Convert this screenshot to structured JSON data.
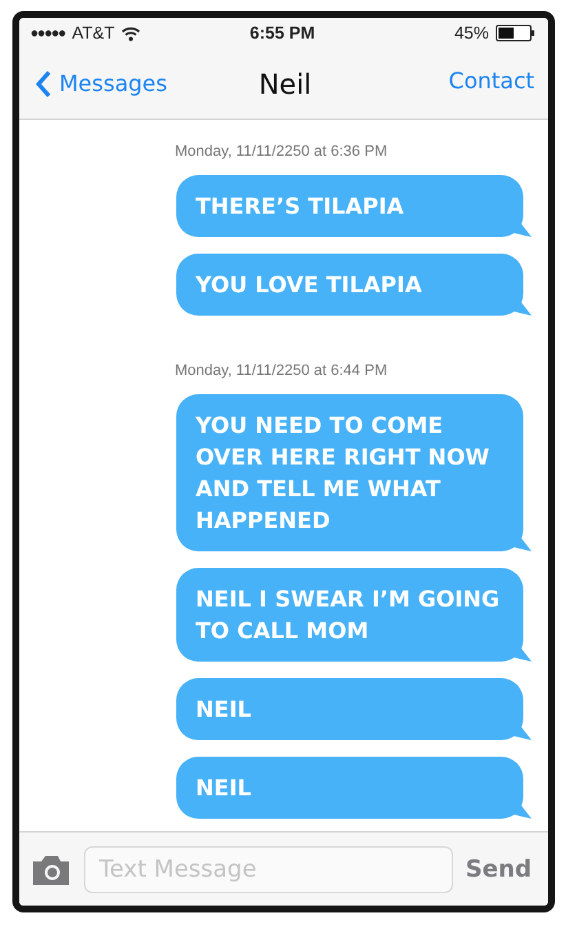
{
  "status_bar": {
    "signal_dots": "●●●●●",
    "carrier": "AT&T",
    "time": "6:55 PM",
    "battery": "45%"
  },
  "nav": {
    "back": "Messages",
    "title": "Neil",
    "action": "Contact"
  },
  "groups": [
    {
      "timestamp": "Monday, 11/11/2250 at 6:36 PM",
      "messages": [
        "THERE’S TILAPIA",
        "YOU LOVE TILAPIA"
      ]
    },
    {
      "timestamp": "Monday, 11/11/2250 at 6:44 PM",
      "messages": [
        "YOU NEED TO COME OVER HERE RIGHT NOW AND TELL ME WHAT HAPPENED",
        "NEIL I SWEAR I’M GOING TO CALL MOM",
        "NEIL",
        "NEIL"
      ]
    }
  ],
  "composer": {
    "placeholder": "Text Message",
    "send": "Send"
  }
}
